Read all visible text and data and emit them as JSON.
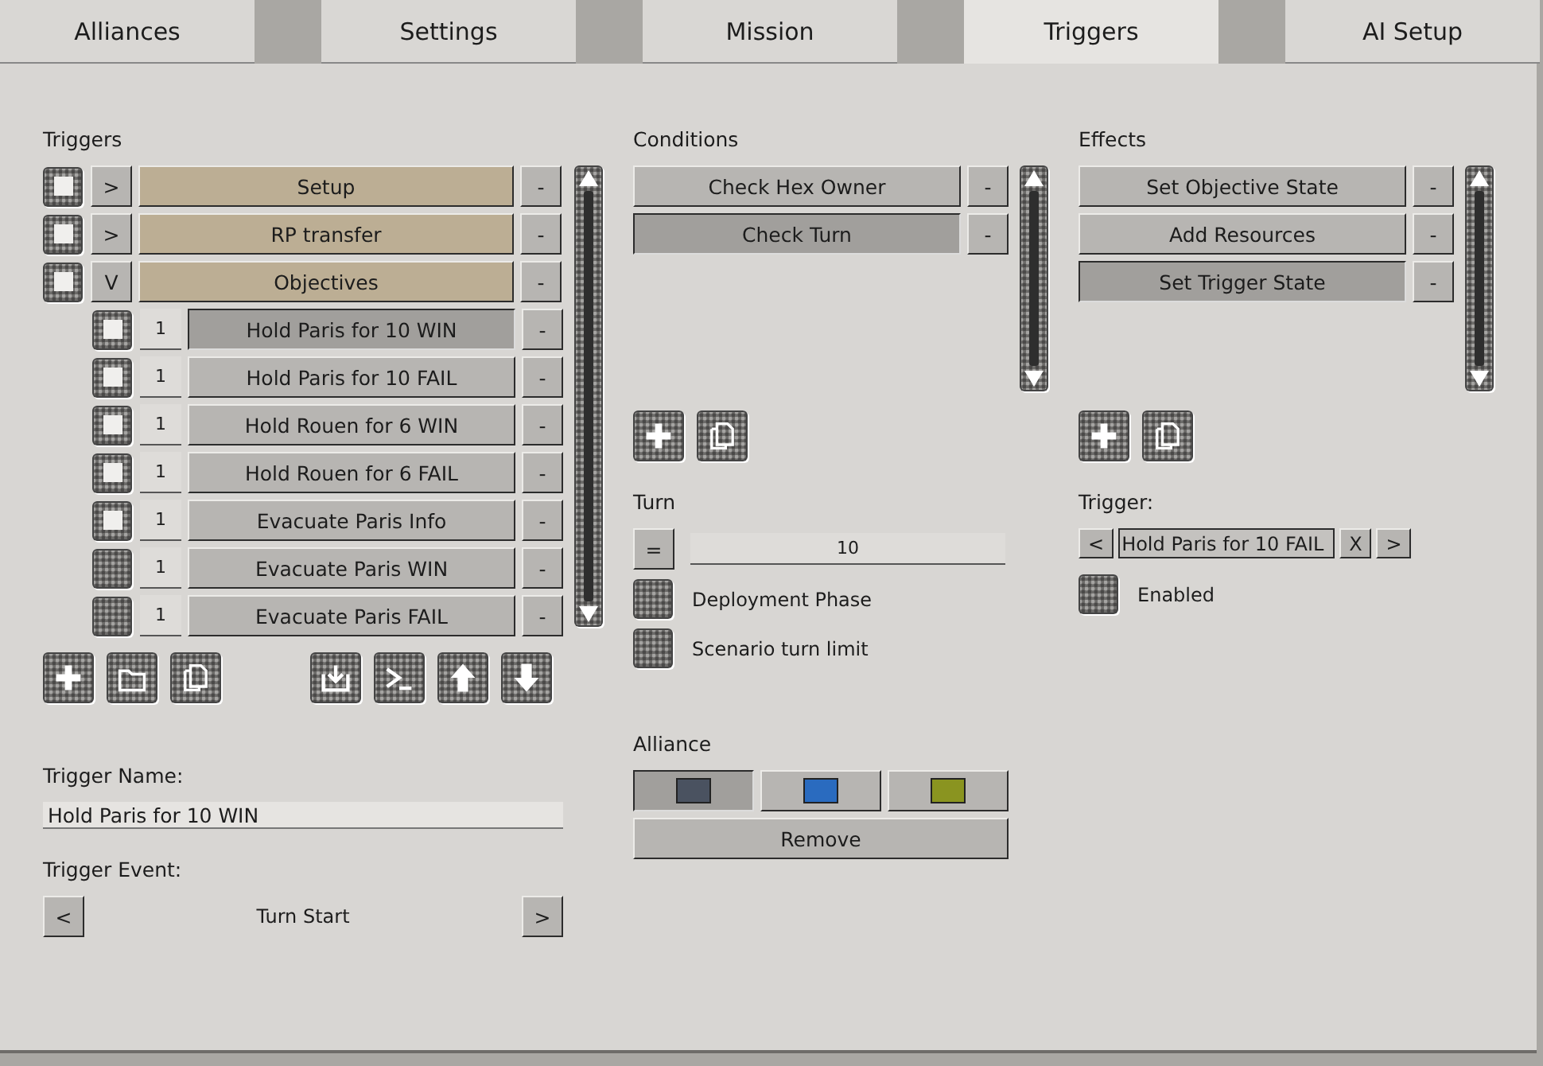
{
  "tabs": [
    {
      "label": "Alliances",
      "selected": false
    },
    {
      "label": "Settings",
      "selected": false
    },
    {
      "label": "Mission",
      "selected": false
    },
    {
      "label": "Triggers",
      "selected": true
    },
    {
      "label": "AI Setup",
      "selected": false
    }
  ],
  "triggers": {
    "title": "Triggers",
    "items": [
      {
        "label": "Setup",
        "checked": true,
        "toggle": ">",
        "selected": false,
        "remove": "-"
      },
      {
        "label": "RP transfer",
        "checked": true,
        "toggle": ">",
        "selected": false,
        "remove": "-"
      },
      {
        "label": "Objectives",
        "checked": true,
        "toggle": "V",
        "selected": false,
        "remove": "-",
        "children": [
          {
            "order": "1",
            "label": "Hold Paris for 10 WIN",
            "checked": true,
            "selected": true,
            "remove": "-"
          },
          {
            "order": "1",
            "label": "Hold Paris for 10 FAIL",
            "checked": true,
            "selected": false,
            "remove": "-"
          },
          {
            "order": "1",
            "label": "Hold Rouen for 6 WIN",
            "checked": true,
            "selected": false,
            "remove": "-"
          },
          {
            "order": "1",
            "label": "Hold Rouen for 6 FAIL",
            "checked": true,
            "selected": false,
            "remove": "-"
          },
          {
            "order": "1",
            "label": "Evacuate Paris Info",
            "checked": true,
            "selected": false,
            "remove": "-"
          },
          {
            "order": "1",
            "label": "Evacuate Paris WIN",
            "checked": false,
            "selected": false,
            "remove": "-"
          },
          {
            "order": "1",
            "label": "Evacuate Paris FAIL",
            "checked": false,
            "selected": false,
            "remove": "-"
          }
        ]
      }
    ]
  },
  "trigger_name": {
    "label": "Trigger Name:",
    "value": "Hold Paris for 10 WIN"
  },
  "trigger_event": {
    "label": "Trigger Event:",
    "prev": "<",
    "value": "Turn Start",
    "next": ">"
  },
  "conditions": {
    "title": "Conditions",
    "items": [
      {
        "label": "Check Hex Owner",
        "selected": false,
        "remove": "-"
      },
      {
        "label": "Check Turn",
        "selected": true,
        "remove": "-"
      }
    ]
  },
  "turn": {
    "title": "Turn",
    "operator": "=",
    "value": "10",
    "options": [
      {
        "label": "Deployment Phase",
        "checked": false
      },
      {
        "label": "Scenario turn limit",
        "checked": false
      }
    ]
  },
  "alliance": {
    "title": "Alliance",
    "swatches": [
      {
        "color": "#4a5260",
        "selected": true
      },
      {
        "color": "#2a6bbf",
        "selected": false
      },
      {
        "color": "#8a9420",
        "selected": false
      }
    ],
    "remove": "Remove"
  },
  "effects": {
    "title": "Effects",
    "items": [
      {
        "label": "Set Objective State",
        "selected": false,
        "remove": "-"
      },
      {
        "label": "Add Resources",
        "selected": false,
        "remove": "-"
      },
      {
        "label": "Set Trigger State",
        "selected": true,
        "remove": "-"
      }
    ]
  },
  "trigger": {
    "label": "Trigger:",
    "prev": "<",
    "value": "Hold Paris for 10 FAIL",
    "clear": "X",
    "next": ">"
  },
  "enabled": {
    "label": "Enabled",
    "checked": false
  }
}
